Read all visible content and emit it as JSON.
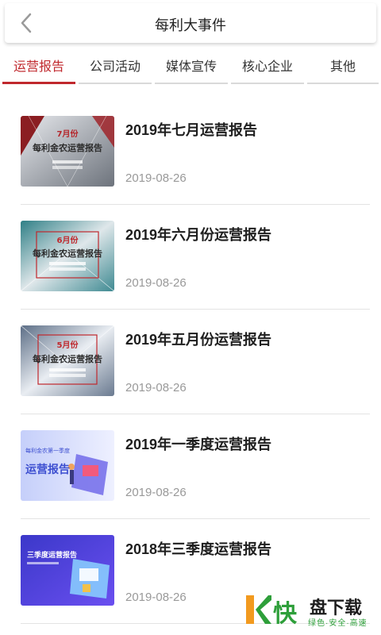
{
  "header": {
    "title": "每利大事件",
    "back_icon": "chevron-left-icon"
  },
  "tabs": [
    {
      "label": "运营报告",
      "active": true
    },
    {
      "label": "公司活动",
      "active": false
    },
    {
      "label": "媒体宣传",
      "active": false
    },
    {
      "label": "核心企业",
      "active": false
    },
    {
      "label": "其他",
      "active": false
    }
  ],
  "accent_color": "#c0282d",
  "items": [
    {
      "title": "2019年七月运营报告",
      "date": "2019-08-26",
      "thumb": {
        "month": "7月份",
        "caption": "每利金农运营报告"
      }
    },
    {
      "title": "2019年六月份运营报告",
      "date": "2019-08-26",
      "thumb": {
        "month": "6月份",
        "caption": "每利金农运营报告"
      }
    },
    {
      "title": "2019年五月份运营报告",
      "date": "2019-08-26",
      "thumb": {
        "month": "5月份",
        "caption": "每利金农运营报告"
      }
    },
    {
      "title": "2019年一季度运营报告",
      "date": "2019-08-26",
      "thumb": {
        "small": "每利金农第一季度",
        "big": "运营报告"
      }
    },
    {
      "title": "2018年三季度运营报告",
      "date": "2019-08-26",
      "thumb": {
        "small": "三季度运营报告"
      }
    }
  ],
  "watermark": {
    "logo_text": "快",
    "brand": "盘下载",
    "slogan": "绿色·安全·高速"
  }
}
